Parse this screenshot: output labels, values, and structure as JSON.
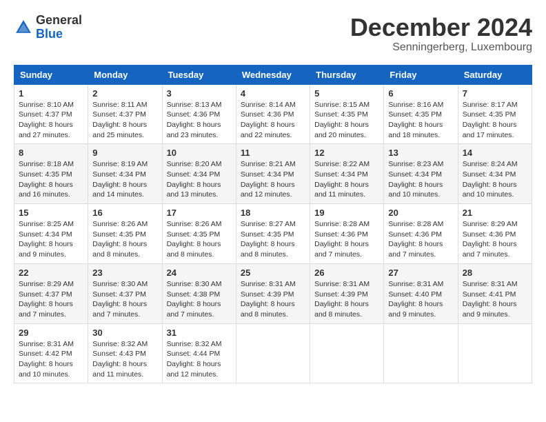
{
  "logo": {
    "general": "General",
    "blue": "Blue"
  },
  "header": {
    "month_year": "December 2024",
    "location": "Senningerberg, Luxembourg"
  },
  "days_of_week": [
    "Sunday",
    "Monday",
    "Tuesday",
    "Wednesday",
    "Thursday",
    "Friday",
    "Saturday"
  ],
  "weeks": [
    [
      {
        "day": "1",
        "sunrise": "8:10 AM",
        "sunset": "4:37 PM",
        "daylight": "8 hours and 27 minutes."
      },
      {
        "day": "2",
        "sunrise": "8:11 AM",
        "sunset": "4:37 PM",
        "daylight": "8 hours and 25 minutes."
      },
      {
        "day": "3",
        "sunrise": "8:13 AM",
        "sunset": "4:36 PM",
        "daylight": "8 hours and 23 minutes."
      },
      {
        "day": "4",
        "sunrise": "8:14 AM",
        "sunset": "4:36 PM",
        "daylight": "8 hours and 22 minutes."
      },
      {
        "day": "5",
        "sunrise": "8:15 AM",
        "sunset": "4:35 PM",
        "daylight": "8 hours and 20 minutes."
      },
      {
        "day": "6",
        "sunrise": "8:16 AM",
        "sunset": "4:35 PM",
        "daylight": "8 hours and 18 minutes."
      },
      {
        "day": "7",
        "sunrise": "8:17 AM",
        "sunset": "4:35 PM",
        "daylight": "8 hours and 17 minutes."
      }
    ],
    [
      {
        "day": "8",
        "sunrise": "8:18 AM",
        "sunset": "4:35 PM",
        "daylight": "8 hours and 16 minutes."
      },
      {
        "day": "9",
        "sunrise": "8:19 AM",
        "sunset": "4:34 PM",
        "daylight": "8 hours and 14 minutes."
      },
      {
        "day": "10",
        "sunrise": "8:20 AM",
        "sunset": "4:34 PM",
        "daylight": "8 hours and 13 minutes."
      },
      {
        "day": "11",
        "sunrise": "8:21 AM",
        "sunset": "4:34 PM",
        "daylight": "8 hours and 12 minutes."
      },
      {
        "day": "12",
        "sunrise": "8:22 AM",
        "sunset": "4:34 PM",
        "daylight": "8 hours and 11 minutes."
      },
      {
        "day": "13",
        "sunrise": "8:23 AM",
        "sunset": "4:34 PM",
        "daylight": "8 hours and 10 minutes."
      },
      {
        "day": "14",
        "sunrise": "8:24 AM",
        "sunset": "4:34 PM",
        "daylight": "8 hours and 10 minutes."
      }
    ],
    [
      {
        "day": "15",
        "sunrise": "8:25 AM",
        "sunset": "4:34 PM",
        "daylight": "8 hours and 9 minutes."
      },
      {
        "day": "16",
        "sunrise": "8:26 AM",
        "sunset": "4:35 PM",
        "daylight": "8 hours and 8 minutes."
      },
      {
        "day": "17",
        "sunrise": "8:26 AM",
        "sunset": "4:35 PM",
        "daylight": "8 hours and 8 minutes."
      },
      {
        "day": "18",
        "sunrise": "8:27 AM",
        "sunset": "4:35 PM",
        "daylight": "8 hours and 8 minutes."
      },
      {
        "day": "19",
        "sunrise": "8:28 AM",
        "sunset": "4:36 PM",
        "daylight": "8 hours and 7 minutes."
      },
      {
        "day": "20",
        "sunrise": "8:28 AM",
        "sunset": "4:36 PM",
        "daylight": "8 hours and 7 minutes."
      },
      {
        "day": "21",
        "sunrise": "8:29 AM",
        "sunset": "4:36 PM",
        "daylight": "8 hours and 7 minutes."
      }
    ],
    [
      {
        "day": "22",
        "sunrise": "8:29 AM",
        "sunset": "4:37 PM",
        "daylight": "8 hours and 7 minutes."
      },
      {
        "day": "23",
        "sunrise": "8:30 AM",
        "sunset": "4:37 PM",
        "daylight": "8 hours and 7 minutes."
      },
      {
        "day": "24",
        "sunrise": "8:30 AM",
        "sunset": "4:38 PM",
        "daylight": "8 hours and 7 minutes."
      },
      {
        "day": "25",
        "sunrise": "8:31 AM",
        "sunset": "4:39 PM",
        "daylight": "8 hours and 8 minutes."
      },
      {
        "day": "26",
        "sunrise": "8:31 AM",
        "sunset": "4:39 PM",
        "daylight": "8 hours and 8 minutes."
      },
      {
        "day": "27",
        "sunrise": "8:31 AM",
        "sunset": "4:40 PM",
        "daylight": "8 hours and 9 minutes."
      },
      {
        "day": "28",
        "sunrise": "8:31 AM",
        "sunset": "4:41 PM",
        "daylight": "8 hours and 9 minutes."
      }
    ],
    [
      {
        "day": "29",
        "sunrise": "8:31 AM",
        "sunset": "4:42 PM",
        "daylight": "8 hours and 10 minutes."
      },
      {
        "day": "30",
        "sunrise": "8:32 AM",
        "sunset": "4:43 PM",
        "daylight": "8 hours and 11 minutes."
      },
      {
        "day": "31",
        "sunrise": "8:32 AM",
        "sunset": "4:44 PM",
        "daylight": "8 hours and 12 minutes."
      },
      null,
      null,
      null,
      null
    ]
  ]
}
